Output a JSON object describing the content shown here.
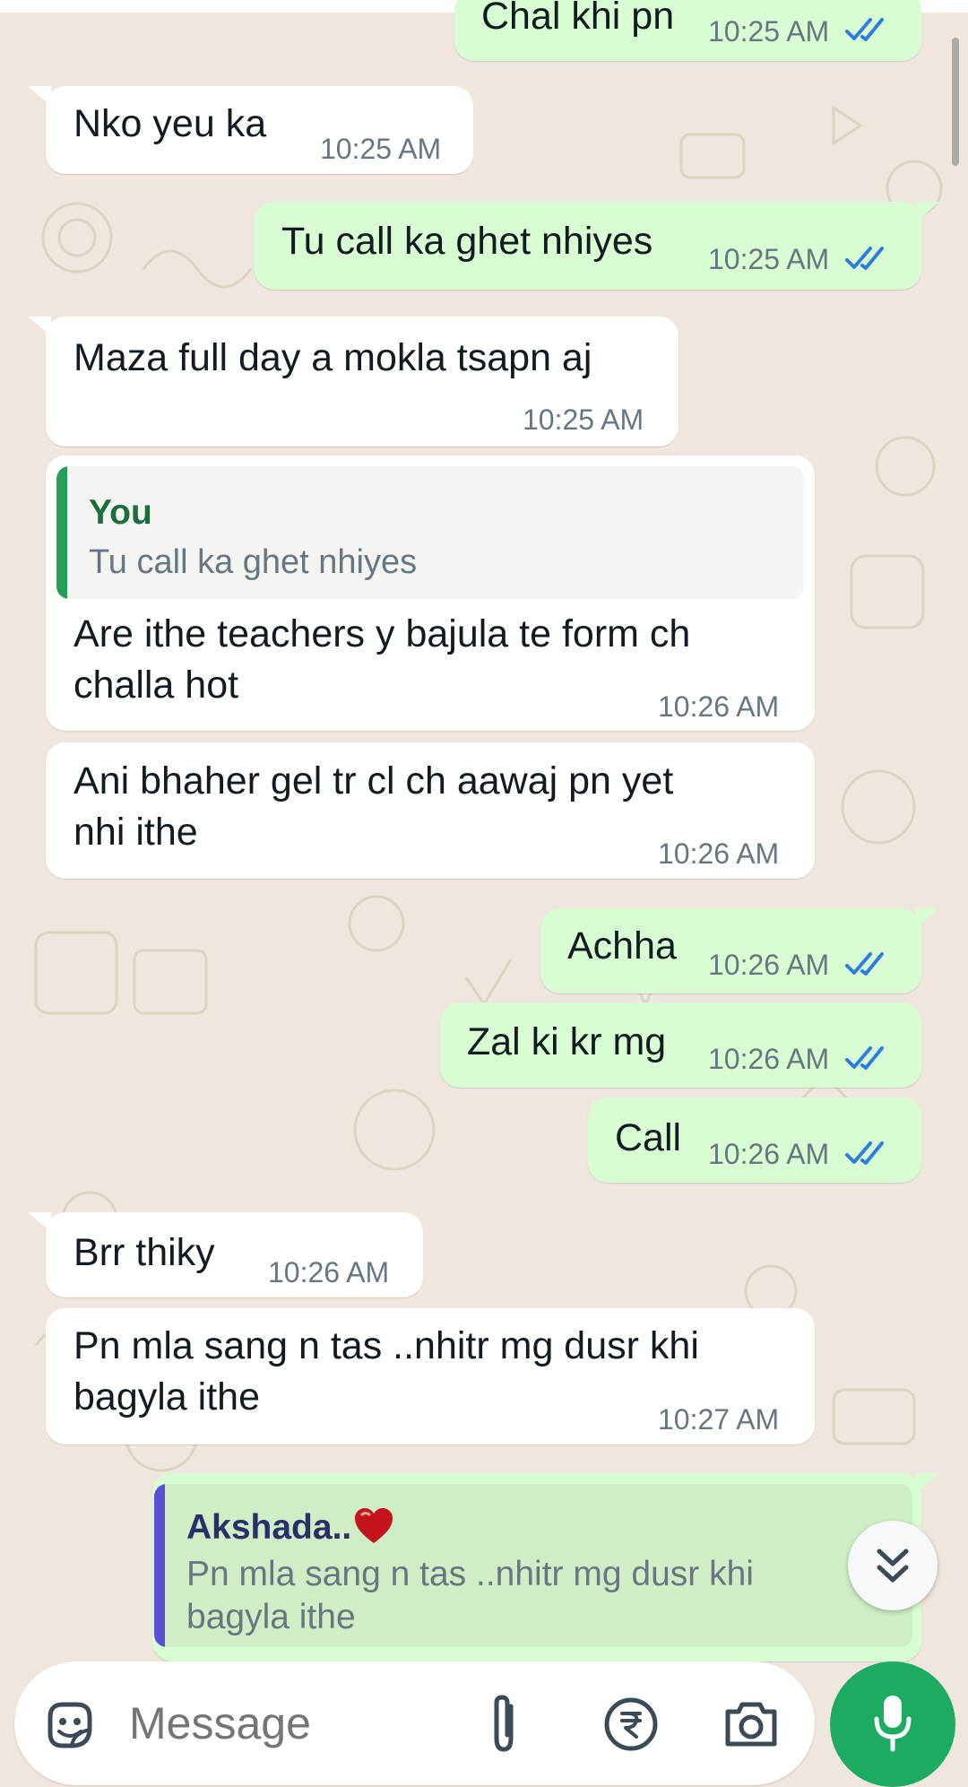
{
  "colors": {
    "background": "#efe7dd",
    "incoming_bubble": "#ffffff",
    "outgoing_bubble": "#d9fdd3",
    "read_ticks": "#2f7de1",
    "timestamp": "#667781",
    "mic_button": "#1daa61",
    "quote_you_bar": "#25a05a",
    "quote_contact_bar": "#5b4fd6"
  },
  "messages": [
    {
      "direction": "out",
      "text": "Chal khi pn",
      "time": "10:25 AM",
      "status": "read"
    },
    {
      "direction": "in",
      "text": "Nko yeu ka",
      "time": "10:25 AM"
    },
    {
      "direction": "out",
      "text": "Tu call ka ghet nhiyes",
      "time": "10:25 AM",
      "status": "read"
    },
    {
      "direction": "in",
      "text": "Maza full day a mokla tsapn aj",
      "time": "10:25 AM"
    },
    {
      "direction": "in",
      "quote": {
        "author": "You",
        "text": "Tu call ka ghet nhiyes"
      },
      "lines": [
        "Are ithe teachers y bajula te form ch",
        "challa hot"
      ],
      "time": "10:26 AM"
    },
    {
      "direction": "in",
      "lines": [
        "Ani bhaher gel tr cl ch aawaj pn yet",
        "nhi ithe"
      ],
      "time": "10:26 AM"
    },
    {
      "direction": "out",
      "text": "Achha",
      "time": "10:26 AM",
      "status": "read"
    },
    {
      "direction": "out",
      "text": "Zal ki kr mg",
      "time": "10:26 AM",
      "status": "read"
    },
    {
      "direction": "out",
      "text": "Call",
      "time": "10:26 AM",
      "status": "read"
    },
    {
      "direction": "in",
      "text": "Brr thiky",
      "time": "10:26 AM"
    },
    {
      "direction": "in",
      "lines": [
        "Pn mla sang n tas ..nhitr mg dusr khi",
        "bagyla ithe"
      ],
      "time": "10:27 AM"
    },
    {
      "direction": "out",
      "quote": {
        "author": "Akshada..",
        "author_icon": "heart-icon",
        "lines": [
          "Pn mla sang n tas ..nhitr mg dusr khi",
          "bagyla ithe"
        ]
      }
    }
  ],
  "composer": {
    "placeholder": "Message",
    "icons": [
      "sticker-icon",
      "attach-icon",
      "rupee-payment-icon",
      "camera-icon",
      "mic-icon"
    ]
  },
  "scroll_down_icon": "double-chevron-down-icon"
}
